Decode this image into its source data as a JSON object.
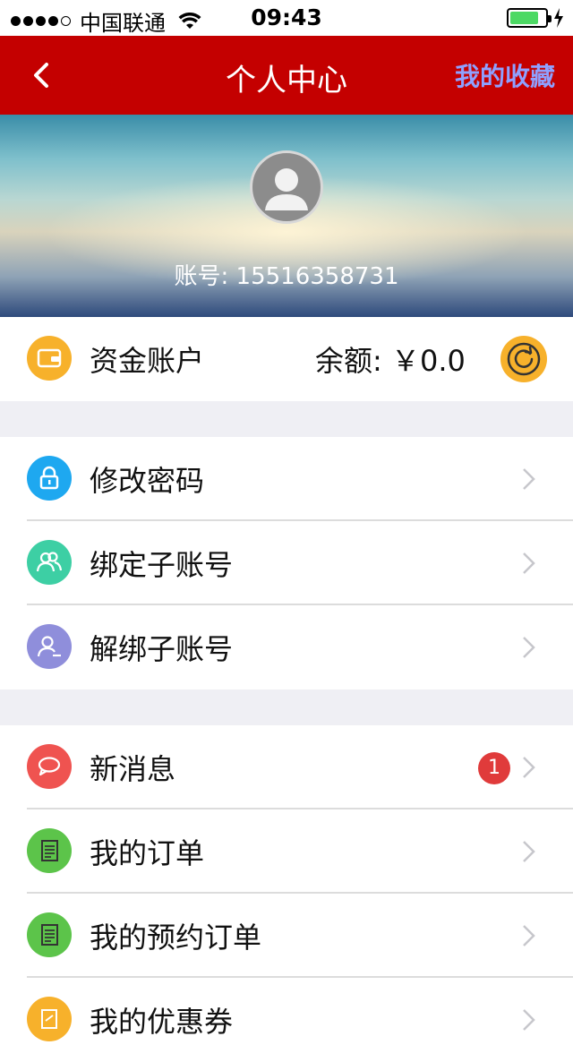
{
  "status_bar": {
    "carrier": "中国联通",
    "time": "09:43"
  },
  "nav": {
    "title": "个人中心",
    "right_link": "我的收藏"
  },
  "profile": {
    "account_label": "账号:",
    "account_number": "15516358731"
  },
  "fund": {
    "label": "资金账户",
    "balance_label": "余额:",
    "balance_value": "￥0.0"
  },
  "menu_group1": [
    {
      "label": "修改密码",
      "icon": "lock-icon",
      "color": "#1ea8f0"
    },
    {
      "label": "绑定子账号",
      "icon": "users-icon",
      "color": "#3dcfa4"
    },
    {
      "label": "解绑子账号",
      "icon": "user-remove-icon",
      "color": "#8f8edb"
    }
  ],
  "menu_group2": [
    {
      "label": "新消息",
      "icon": "message-icon",
      "color": "#ef5350",
      "badge": "1"
    },
    {
      "label": "我的订单",
      "icon": "order-icon",
      "color": "#5cc44a"
    },
    {
      "label": "我的预约订单",
      "icon": "reservation-order-icon",
      "color": "#5cc44a"
    },
    {
      "label": "我的优惠券",
      "icon": "coupon-icon",
      "color": "#f7b12b"
    }
  ],
  "colors": {
    "nav_red": "#c40000",
    "accent_link": "#8fa0ff",
    "wallet_orange": "#f7b12b"
  }
}
